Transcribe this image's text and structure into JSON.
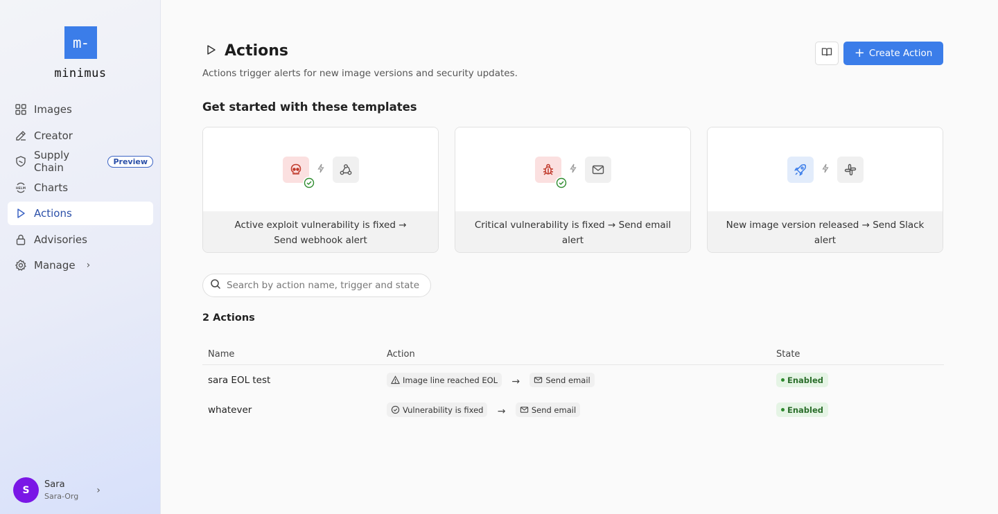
{
  "brand": {
    "logo_mark": "m-",
    "name": "minimus",
    "accent": "#3b7de9"
  },
  "sidebar": {
    "items": [
      {
        "label": "Images",
        "icon": "grid-icon"
      },
      {
        "label": "Creator",
        "icon": "pencil-icon"
      },
      {
        "label": "Supply Chain",
        "icon": "shield-icon",
        "badge": "Preview"
      },
      {
        "label": "Charts",
        "icon": "helm-icon"
      },
      {
        "label": "Actions",
        "icon": "play-icon",
        "active": true
      },
      {
        "label": "Advisories",
        "icon": "lock-icon"
      },
      {
        "label": "Manage",
        "icon": "gear-icon"
      }
    ]
  },
  "user": {
    "initial": "S",
    "name": "Sara",
    "org": "Sara-Org",
    "avatar_color": "#7a17e6"
  },
  "header": {
    "title": "Actions",
    "subtitle": "Actions trigger alerts for new image versions and security updates.",
    "create_label": "Create Action"
  },
  "templates": {
    "heading": "Get started with these templates",
    "cards": [
      {
        "trigger": "Active exploit vulnerability is fixed",
        "arrow": "→",
        "action": "Send webhook alert"
      },
      {
        "trigger": "Critical vulnerability is fixed",
        "arrow": "→",
        "action": "Send email alert"
      },
      {
        "trigger": "New image version released",
        "arrow": "→",
        "action": "Send Slack alert"
      }
    ]
  },
  "search": {
    "placeholder": "Search by action name, trigger and state"
  },
  "actions_list": {
    "count_label": "2 Actions",
    "columns": {
      "name": "Name",
      "action": "Action",
      "state": "State"
    },
    "rows": [
      {
        "name": "sara EOL test",
        "trigger": "Image line reached EOL",
        "action": "Send email",
        "state": "Enabled"
      },
      {
        "name": "whatever",
        "trigger": "Vulnerability is fixed",
        "action": "Send email",
        "state": "Enabled"
      }
    ]
  }
}
